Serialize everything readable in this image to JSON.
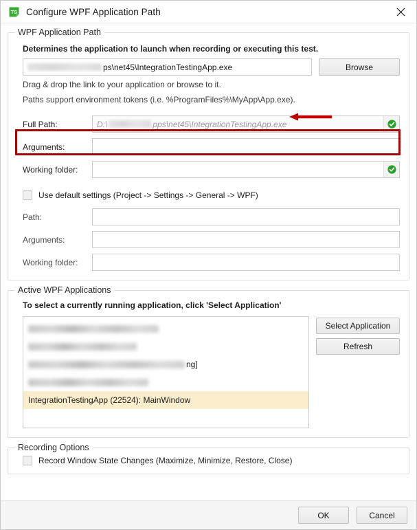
{
  "window": {
    "title": "Configure WPF Application Path",
    "app_icon": "test-studio-icon",
    "close_icon": "close-icon"
  },
  "app_path_group": {
    "legend": "WPF Application Path",
    "description": "Determines the application to launch when recording or executing this test.",
    "path_input": {
      "value_visible": "ps\\net45\\IntegrationTestingApp.exe",
      "redacted_prefix": true
    },
    "browse_label": "Browse",
    "hint_drag": "Drag & drop the link to your application or browse to it.",
    "hint_tokens": "Paths support environment tokens (i.e. %ProgramFiles%\\MyApp\\App.exe).",
    "full_path": {
      "label": "Full Path:",
      "value_prefix": "D:\\",
      "value_suffix": "pps\\net45\\IntegrationTestingApp.exe",
      "redacted": true,
      "status_icon": "check-circle-icon",
      "disabled": true
    },
    "arguments": {
      "label": "Arguments:",
      "value": "",
      "placeholder": ""
    },
    "working_folder": {
      "label": "Working folder:",
      "value": "",
      "placeholder": "",
      "status_icon": "check-circle-icon"
    },
    "use_default_settings": {
      "label": "Use default settings (Project -> Settings -> General -> WPF)",
      "checked": false
    },
    "default_path": {
      "label": "Path:",
      "value": ""
    },
    "default_arguments": {
      "label": "Arguments:",
      "value": ""
    },
    "default_working_folder": {
      "label": "Working folder:",
      "value": ""
    }
  },
  "active_apps_group": {
    "legend": "Active WPF Applications",
    "description": "To select a currently running application, click 'Select Application'",
    "items": [
      {
        "label": "",
        "redacted": true,
        "blur_width": 190,
        "tail": "",
        "selected": false
      },
      {
        "label": "",
        "redacted": true,
        "blur_width": 158,
        "tail": "",
        "selected": false
      },
      {
        "label": "",
        "redacted": true,
        "blur_width": 228,
        "tail": "ng]",
        "selected": false
      },
      {
        "label": "",
        "redacted": true,
        "blur_width": 175,
        "tail": "",
        "selected": false
      },
      {
        "label": "IntegrationTestingApp (22524): MainWindow",
        "redacted": false,
        "blur_width": 0,
        "tail": "",
        "selected": true
      }
    ],
    "select_application_label": "Select Application",
    "refresh_label": "Refresh"
  },
  "recording_options_group": {
    "legend": "Recording Options",
    "record_window_state": {
      "label": "Record Window State Changes (Maximize, Minimize, Restore, Close)",
      "checked": false
    }
  },
  "footer": {
    "ok_label": "OK",
    "cancel_label": "Cancel"
  },
  "annotations": {
    "highlight_color": "#a00707",
    "arrow_color": "#c00000",
    "selected_row_color": "#fbeecd",
    "status_ok_color": "#2aa02a"
  }
}
